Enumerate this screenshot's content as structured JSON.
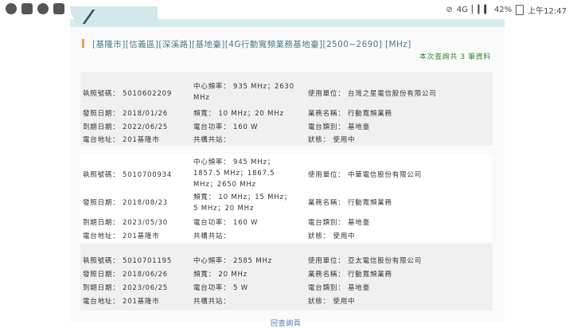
{
  "status_bar": {
    "left_icons": [
      "line-icon",
      "gallery-icon",
      "leaf-icon",
      "instagram-icon"
    ],
    "network": "4G",
    "battery": "42%",
    "time": "上午12:47"
  },
  "search": {
    "criteria": "[基隆市][信義區][深溪路][基地臺][4G行動寬頻業務基地臺][2500~2690] [MHz]",
    "result_count": "本次查詢共 3 筆資料"
  },
  "records": [
    {
      "license": "執照號碼： 5010602209",
      "freq": [
        "中心頻率： 935 MHz；2630",
        "MHz"
      ],
      "user": "使用單位： 台灣之星電信股份有限公司",
      "issue": "發照日期： 2018/01/26",
      "bandwidth": [
        "頻寬： 10 MHz；20 MHz"
      ],
      "service": "業務名稱： 行動寬頻業務",
      "expiry": "到期日期： 2022/06/25",
      "power": "電台功率： 160 W",
      "category": "電台類別： 基地臺",
      "address": "電台地址： 201基隆市",
      "shared": "共構共站：",
      "status": "狀態： 使用中"
    },
    {
      "license": "執照號碼： 5010700934",
      "freq": [
        "中心頻率： 945 MHz；",
        "1857.5 MHz；1867.5",
        "MHz；2650 MHz"
      ],
      "user": "使用單位： 中華電信股份有限公司",
      "issue": "發照日期： 2018/08/23",
      "bandwidth": [
        "頻寬： 10 MHz；15 MHz；",
        "5 MHz；20 MHz"
      ],
      "service": "業務名稱： 行動寬頻業務",
      "expiry": "到期日期： 2023/05/30",
      "power": "電台功率： 160 W",
      "category": "電台類別： 基地臺",
      "address": "電台地址： 201基隆市",
      "shared": "共構共站：",
      "status": "狀態： 使用中"
    },
    {
      "license": "執照號碼： 5010701195",
      "freq": [
        "中心頻率： 2585 MHz"
      ],
      "user": "使用單位： 亞太電信股份有限公司",
      "issue": "發照日期： 2018/06/26",
      "bandwidth": [
        "頻寬： 20 MHz"
      ],
      "service": "業務名稱： 行動寬頻業務",
      "expiry": "到期日期： 2023/06/25",
      "power": "電台功率： 5 W",
      "category": "電台類別： 基地臺",
      "address": "電台地址： 201基隆市",
      "shared": "共構共站：",
      "status": "狀態： 使用中"
    }
  ],
  "footer": {
    "back_link": "回查詢頁"
  }
}
